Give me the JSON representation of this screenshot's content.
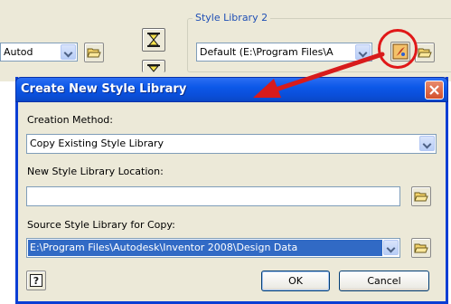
{
  "background": {
    "group_label": "Style Library 2",
    "left_combo_value": "Autod",
    "right_combo_value": "Default  (E:\\Program Files\\A"
  },
  "dialog": {
    "title": "Create New Style Library",
    "creation_method_label": "Creation Method:",
    "creation_method_value": "Copy Existing Style Library",
    "location_label": "New Style Library Location:",
    "location_value": "",
    "source_label": "Source Style Library for Copy:",
    "source_value": "E:\\Program Files\\Autodesk\\Inventor 2008\\Design Data",
    "ok_label": "OK",
    "cancel_label": "Cancel"
  },
  "colors": {
    "title_bar": "#0a4ed9",
    "annotation": "#e01818",
    "selection": "#316ac5"
  },
  "icons": [
    "folder-open-icon",
    "hourglass-icon",
    "style-library-icon",
    "close-icon",
    "help-icon",
    "chevron-down-icon"
  ]
}
